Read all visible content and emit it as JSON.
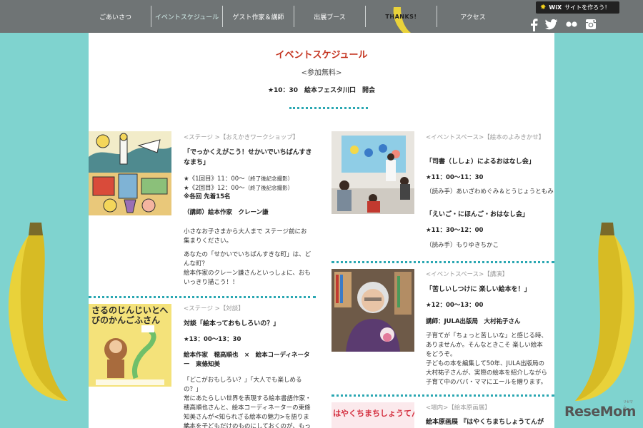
{
  "nav": {
    "items": [
      "ごあいさつ",
      "イベントスケジュール",
      "ゲスト作家＆講師",
      "出展ブース",
      "THANKS!",
      "アクセス"
    ],
    "active_index": 1
  },
  "wix_badge": {
    "label": "サイトを作ろう！",
    "brand": "WiX"
  },
  "social_icons": [
    "facebook-icon",
    "twitter-icon",
    "flickr-icon",
    "instagram-icon"
  ],
  "page": {
    "title": "イベントスケジュール",
    "subtitle": "<参加無料>",
    "opening": "★10：30　絵本フェスタ川口　開会"
  },
  "events": {
    "workshop": {
      "category": "<ステージ >【おえかきワークショップ】",
      "title": "「でっかくえがこう！せかいでいちばんすきなまち」",
      "time1": "★《1回目》11：00～",
      "time1_note": "（終了後記念撮影）",
      "time2": "★《2回目》12：00～",
      "time2_note": "（終了後記念撮影）",
      "capacity": "※各回 先着15名",
      "lecturer": "（講師）絵本作家　クレーン謙",
      "desc1": "小さなお子さまから大人まで ステージ前にお集まりください。",
      "desc2": "あなたの「せかいでいちばんすきな町」は、どんな町？",
      "desc3": "絵本作家のクレーン謙さんといっしょに、おもいっきり描こう！！"
    },
    "storytime": {
      "category": "<イベントスペース>【絵本のよみきかせ】",
      "title1": "「司書（ししょ）によるおはなし会」",
      "time1": "★11：00～11：30",
      "readers1": "（読み手）あいざわめぐみ＆とうじょうともみ",
      "title2": "「えいご・にほんご・おはなし会」",
      "time2": "★11：30～12：00",
      "readers2": "（読み手）もりゆきちかこ"
    },
    "talk": {
      "category": "<ステージ >【対談】",
      "title": "対談「絵本っておもしろいの？」",
      "time": "★13：00～13：30",
      "speakers": "絵本作家　穂高順也　×　絵本コーディネーター　東條知美",
      "desc1": "「どこがおもしろい？」「大人でも楽しめるの？」",
      "desc2": "常にあたらしい世界を表現する絵本書語作家・穂高順也さんと、絵本コーディネーターの東條知美さんが<知られざる絵本の魅力>を語ります。",
      "desc3": "絵本を子どもだけのものにしておくのが、もった"
    },
    "lecture": {
      "category": "<イベントスペース>【講演】",
      "title": "「苦しいしつけに 楽しい絵本を！」",
      "time": "★12：00～13：00",
      "lecturer": "講師：JULA出版局　大村祐子さん",
      "desc1": "子育てが「ちょっと苦しいな」と感じる時、ありませんか。そんなときこそ 楽しい絵本をどうぞ。",
      "desc2": "子どもの本を編集して50年、JULA出版局の大村祐子さんが、実際の絵本を紹介しながら子育て中のパパ・ママにエールを贈ります。"
    },
    "exhibit": {
      "category": "<場内>【絵本原画展】",
      "title": "絵本原画展 『はやくちまちしょうてんが",
      "book_cover_text": "はやくちまちしょうてんがい"
    }
  },
  "thumbnails": {
    "talk_book_title": "さるのじんじいとへびのかんごふさん"
  },
  "watermark": {
    "text": "ReseMom",
    "small": "リセマム"
  },
  "colors": {
    "background": "#7fd3cf",
    "topbar": "#6f7475",
    "title_red": "#c4331f",
    "dots": "#2aa7b2",
    "banana": "#e9d23a"
  }
}
